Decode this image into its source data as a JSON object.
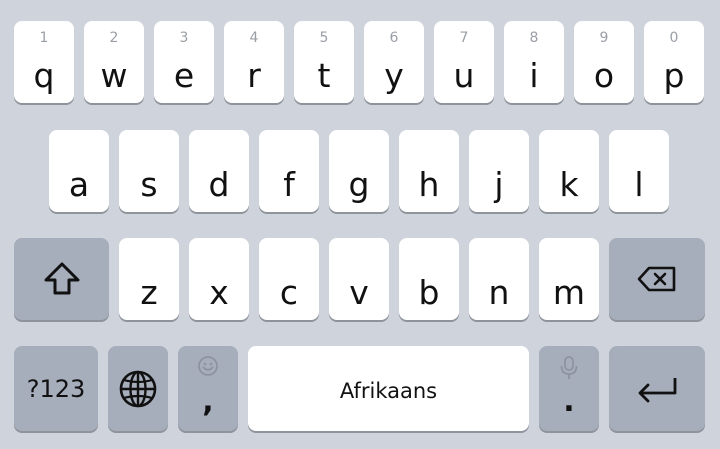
{
  "keyboard": {
    "row1": [
      {
        "key": "q",
        "hint": "1"
      },
      {
        "key": "w",
        "hint": "2"
      },
      {
        "key": "e",
        "hint": "3"
      },
      {
        "key": "r",
        "hint": "4"
      },
      {
        "key": "t",
        "hint": "5"
      },
      {
        "key": "y",
        "hint": "6"
      },
      {
        "key": "u",
        "hint": "7"
      },
      {
        "key": "i",
        "hint": "8"
      },
      {
        "key": "o",
        "hint": "9"
      },
      {
        "key": "p",
        "hint": "0"
      }
    ],
    "row2": [
      "a",
      "s",
      "d",
      "f",
      "g",
      "h",
      "j",
      "k",
      "l"
    ],
    "row3": [
      "z",
      "x",
      "c",
      "v",
      "b",
      "n",
      "m"
    ],
    "symbols_label": "?123",
    "comma_label": ",",
    "space_label": "Afrikaans",
    "period_label": ".",
    "icons": {
      "shift": "shift-arrow-icon",
      "backspace": "backspace-icon",
      "language": "globe-icon",
      "emoji": "smiley-icon",
      "voice": "microphone-icon",
      "enter": "enter-return-icon"
    },
    "colors": {
      "background": "#cfd3dc",
      "letter_key": "#ffffff",
      "function_key": "#a6adbb",
      "hint_text": "#9a9ea6"
    }
  }
}
